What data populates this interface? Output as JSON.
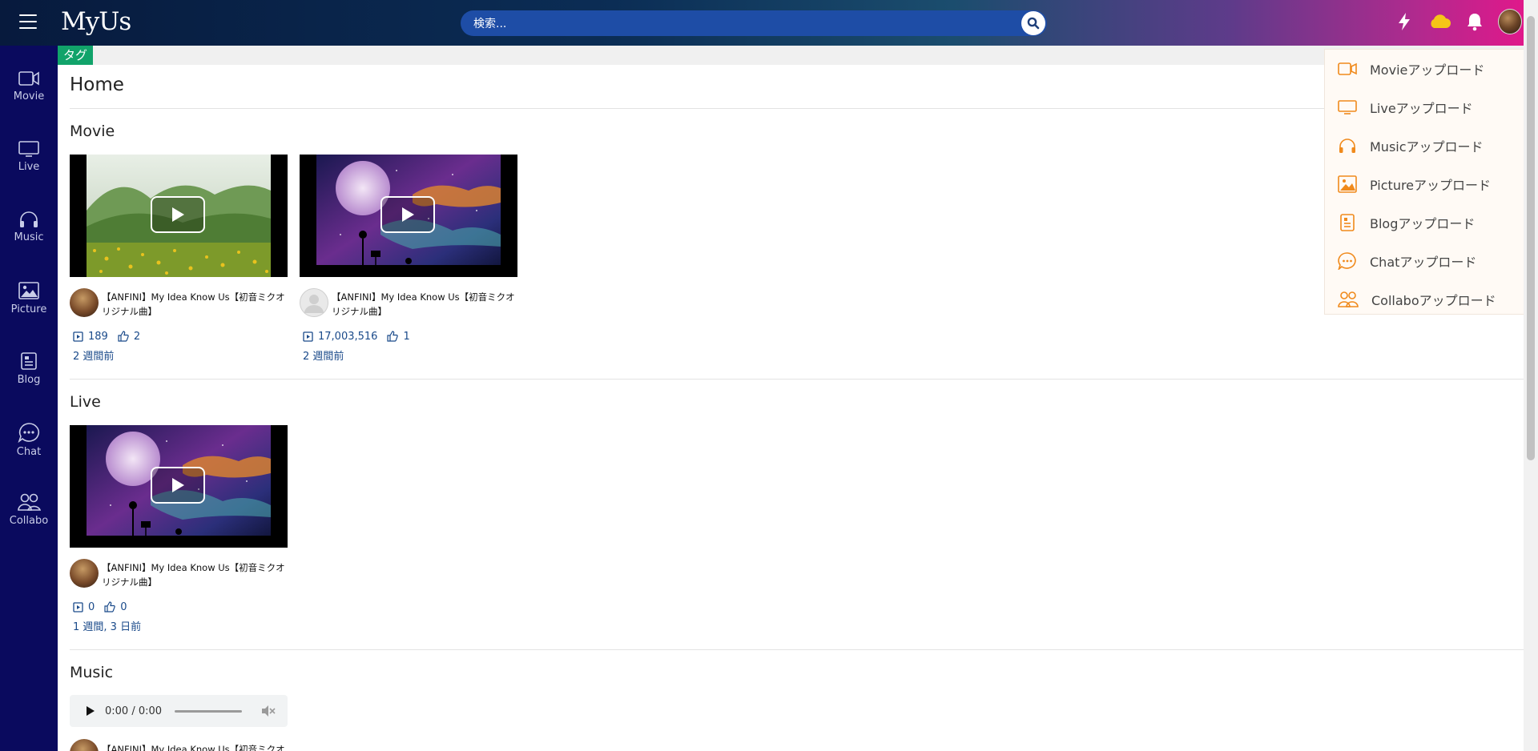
{
  "header": {
    "logo": "MyUs",
    "search_placeholder": "検索..."
  },
  "sidebar": {
    "items": [
      {
        "label": "Movie",
        "icon": "video-icon"
      },
      {
        "label": "Live",
        "icon": "monitor-icon"
      },
      {
        "label": "Music",
        "icon": "headphones-icon"
      },
      {
        "label": "Picture",
        "icon": "image-icon"
      },
      {
        "label": "Blog",
        "icon": "document-icon"
      },
      {
        "label": "Chat",
        "icon": "chat-icon"
      },
      {
        "label": "Collabo",
        "icon": "users-icon"
      }
    ]
  },
  "tag_label": "タグ",
  "page_title": "Home",
  "sections": {
    "movie": {
      "title": "Movie",
      "cards": [
        {
          "title": "【ANFINI】My Idea Know Us【初音ミクオリジナル曲】",
          "views": "189",
          "likes": "2",
          "ago": "2 週間前",
          "avatar": "photo"
        },
        {
          "title": "【ANFINI】My Idea Know Us【初音ミクオリジナル曲】",
          "views": "17,003,516",
          "likes": "1",
          "ago": "2 週間前",
          "avatar": "default"
        }
      ]
    },
    "live": {
      "title": "Live",
      "cards": [
        {
          "title": "【ANFINI】My Idea Know Us【初音ミクオリジナル曲】",
          "views": "0",
          "likes": "0",
          "ago": "1 週間, 3 日前",
          "avatar": "photo"
        }
      ]
    },
    "music": {
      "title": "Music",
      "player_time": "0:00 / 0:00",
      "next_card_title": "【ANFINI】My Idea Know Us【初音ミクオ"
    }
  },
  "upload_menu": {
    "items": [
      {
        "label": "Movieアップロード",
        "icon": "video-icon"
      },
      {
        "label": "Liveアップロード",
        "icon": "monitor-icon"
      },
      {
        "label": "Musicアップロード",
        "icon": "headphones-icon"
      },
      {
        "label": "Pictureアップロード",
        "icon": "image-icon"
      },
      {
        "label": "Blogアップロード",
        "icon": "document-icon"
      },
      {
        "label": "Chatアップロード",
        "icon": "chat-icon"
      },
      {
        "label": "Collaboアップロード",
        "icon": "users-icon"
      }
    ]
  },
  "colors": {
    "sidebar": "#0a0a5e",
    "tag": "#11a36a",
    "accent_orange": "#f08a1c",
    "link_blue": "#1a4a8a",
    "search_bg": "#1e4da6"
  }
}
